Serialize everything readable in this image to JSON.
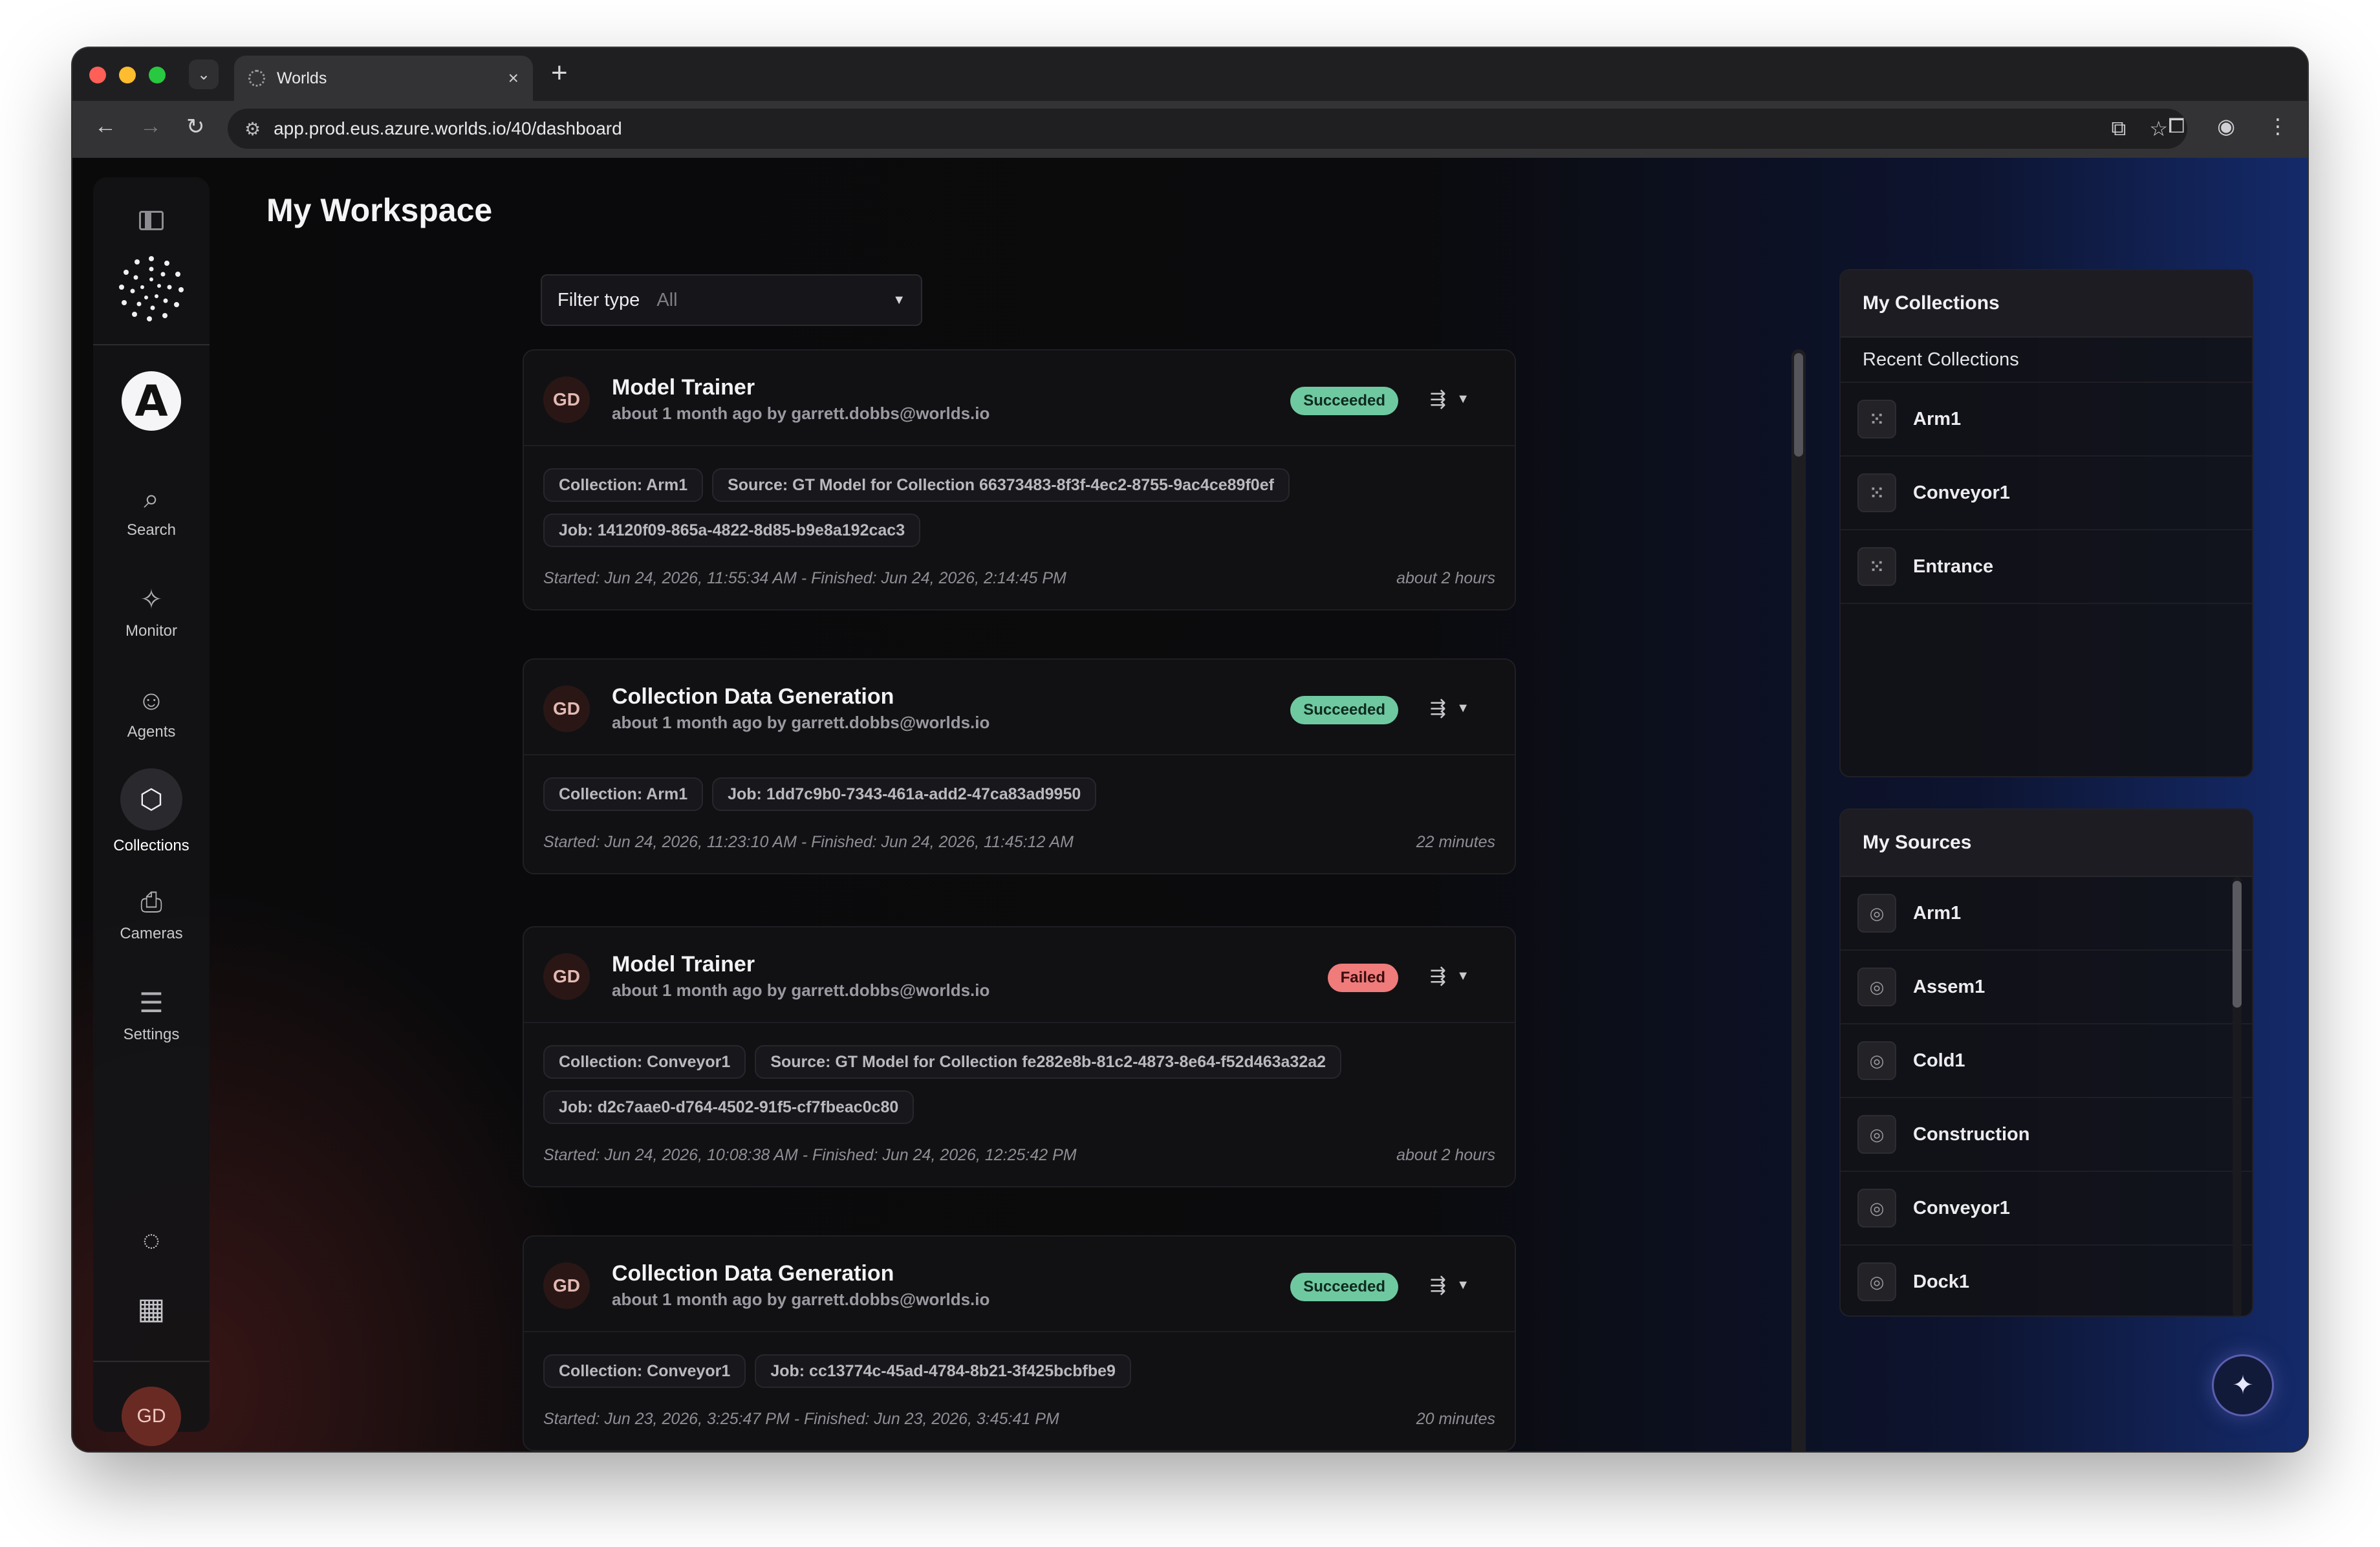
{
  "browser": {
    "tab_title": "Worlds",
    "url": "app.prod.eus.azure.worlds.io/40/dashboard"
  },
  "rail": {
    "org_initial": "A",
    "user_initials": "GD",
    "items": [
      {
        "label": "Search",
        "icon": "search-icon"
      },
      {
        "label": "Monitor",
        "icon": "monitor-icon"
      },
      {
        "label": "Agents",
        "icon": "robot-icon"
      },
      {
        "label": "Collections",
        "icon": "collections-icon",
        "active": true
      },
      {
        "label": "Cameras",
        "icon": "camera-icon"
      },
      {
        "label": "Settings",
        "icon": "sliders-icon"
      }
    ]
  },
  "main": {
    "title": "My Workspace",
    "filter": {
      "label": "Filter type",
      "value": "All"
    }
  },
  "feed": [
    {
      "initials": "GD",
      "title": "Model Trainer",
      "subtitle": "about 1 month ago by garrett.dobbs@worlds.io",
      "status": "Succeeded",
      "tags": [
        "Collection: Arm1",
        "Source: GT Model for Collection 66373483-8f3f-4ec2-8755-9ac4ce89f0ef",
        "Job: 14120f09-865a-4822-8d85-b9e8a192cac3"
      ],
      "timing": "Started: Jun 24, 2026, 11:55:34 AM - Finished: Jun 24, 2026, 2:14:45 PM",
      "duration": "about 2 hours"
    },
    {
      "initials": "GD",
      "title": "Collection Data Generation",
      "subtitle": "about 1 month ago by garrett.dobbs@worlds.io",
      "status": "Succeeded",
      "tags": [
        "Collection: Arm1",
        "Job: 1dd7c9b0-7343-461a-add2-47ca83ad9950"
      ],
      "timing": "Started: Jun 24, 2026, 11:23:10 AM - Finished: Jun 24, 2026, 11:45:12 AM",
      "duration": "22 minutes"
    },
    {
      "initials": "GD",
      "title": "Model Trainer",
      "subtitle": "about 1 month ago by garrett.dobbs@worlds.io",
      "status": "Failed",
      "tags": [
        "Collection: Conveyor1",
        "Source: GT Model for Collection fe282e8b-81c2-4873-8e64-f52d463a32a2",
        "Job: d2c7aae0-d764-4502-91f5-cf7fbeac0c80"
      ],
      "timing": "Started: Jun 24, 2026, 10:08:38 AM - Finished: Jun 24, 2026, 12:25:42 PM",
      "duration": "about 2 hours"
    },
    {
      "initials": "GD",
      "title": "Collection Data Generation",
      "subtitle": "about 1 month ago by garrett.dobbs@worlds.io",
      "status": "Succeeded",
      "tags": [
        "Collection: Conveyor1",
        "Job: cc13774c-45ad-4784-8b21-3f425bcbfbe9"
      ],
      "timing": "Started: Jun 23, 2026, 3:25:47 PM - Finished: Jun 23, 2026, 3:45:41 PM",
      "duration": "20 minutes"
    }
  ],
  "collections": {
    "title": "My Collections",
    "subtitle": "Recent Collections",
    "items": [
      "Arm1",
      "Conveyor1",
      "Entrance"
    ]
  },
  "sources": {
    "title": "My Sources",
    "items": [
      "Arm1",
      "Assem1",
      "Cold1",
      "Construction",
      "Conveyor1",
      "Dock1"
    ]
  },
  "colors": {
    "succeeded": "#6fc9a0",
    "failed": "#f07b7b",
    "accent": "#5a5fb0"
  }
}
